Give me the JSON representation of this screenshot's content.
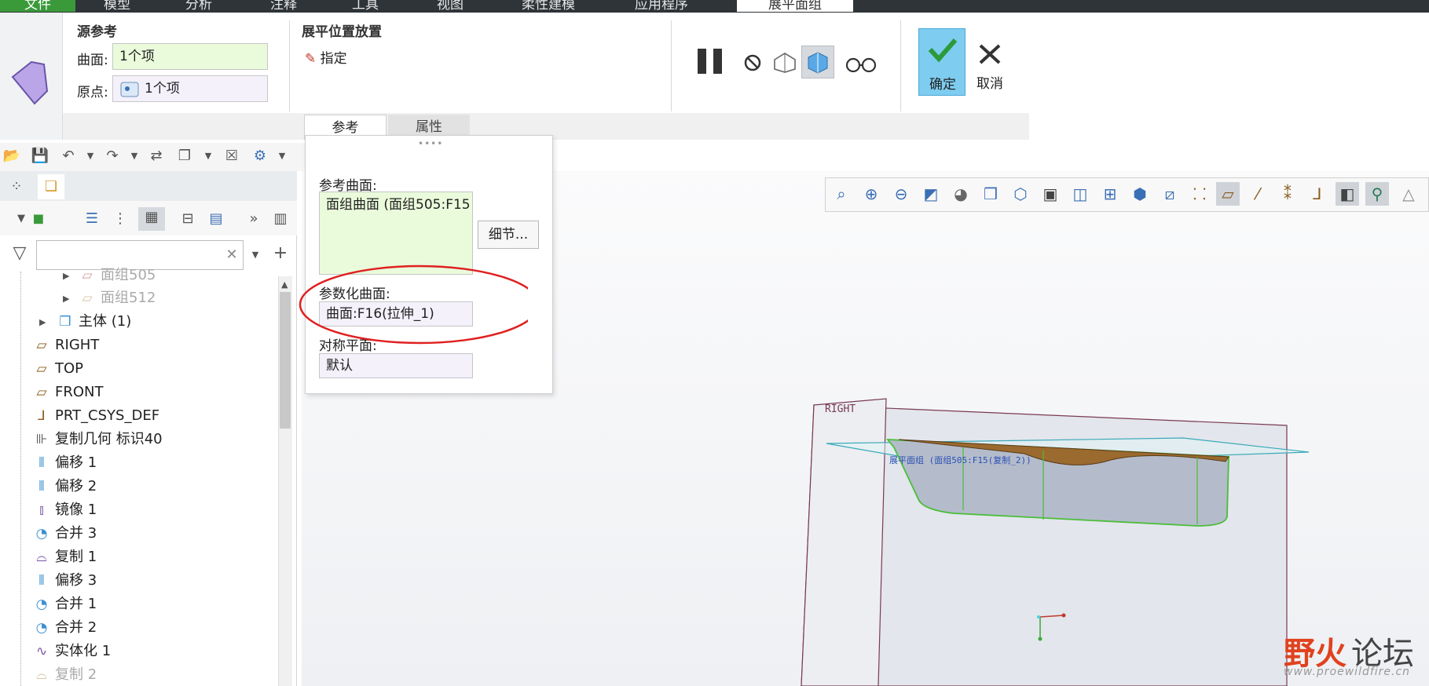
{
  "menu": {
    "tabs": [
      "文件",
      "模型",
      "分析",
      "注释",
      "工具",
      "视图",
      "柔性建模",
      "应用程序",
      "展平面组"
    ],
    "active_tab": "展平面组"
  },
  "ribbon": {
    "source_ref": {
      "title": "源参考",
      "surface_label": "曲面:",
      "surface_value": "1个项",
      "origin_label": "原点:",
      "origin_value": "1个项"
    },
    "placement": {
      "title": "展平位置放置",
      "specify_label": "指定"
    },
    "confirm_label": "确定",
    "cancel_label": "取消"
  },
  "panel_tabs": {
    "references": "参考",
    "properties": "属性"
  },
  "ref_panel": {
    "ref_surface_label": "参考曲面:",
    "ref_surface_value": "面组曲面 (面组505:F15",
    "details_button": "细节...",
    "param_surface_label": "参数化曲面:",
    "param_surface_value": "曲面:F16(拉伸_1)",
    "sym_plane_label": "对称平面:",
    "sym_plane_value": "默认"
  },
  "model_tree": {
    "items": [
      {
        "label": "面组505",
        "icon": "quilt-icon",
        "dim": true
      },
      {
        "label": "面组512",
        "icon": "quilt-icon",
        "dim": true
      },
      {
        "label": "主体 (1)",
        "icon": "body-icon",
        "dim": false
      },
      {
        "label": "RIGHT",
        "icon": "datum-plane-icon",
        "dim": false
      },
      {
        "label": "TOP",
        "icon": "datum-plane-icon",
        "dim": false
      },
      {
        "label": "FRONT",
        "icon": "datum-plane-icon",
        "dim": false
      },
      {
        "label": "PRT_CSYS_DEF",
        "icon": "csys-icon",
        "dim": false
      },
      {
        "label": "复制几何 标识40",
        "icon": "copy-geom-icon",
        "dim": false
      },
      {
        "label": "偏移 1",
        "icon": "offset-icon",
        "dim": false
      },
      {
        "label": "偏移 2",
        "icon": "offset-icon",
        "dim": false
      },
      {
        "label": "镜像 1",
        "icon": "mirror-icon",
        "dim": false
      },
      {
        "label": "合并 3",
        "icon": "merge-icon",
        "dim": false
      },
      {
        "label": "复制 1",
        "icon": "copy-icon",
        "dim": false
      },
      {
        "label": "偏移 3",
        "icon": "offset-icon",
        "dim": false
      },
      {
        "label": "合并 1",
        "icon": "merge-icon",
        "dim": false
      },
      {
        "label": "合并 2",
        "icon": "merge-icon",
        "dim": false
      },
      {
        "label": "实体化 1",
        "icon": "solidify-icon",
        "dim": false
      },
      {
        "label": "复制 2",
        "icon": "copy-icon",
        "dim": true
      }
    ]
  },
  "viewport": {
    "datum_label": "RIGHT",
    "annotation": "展平面组 (面组505:F15(复制_2))"
  },
  "watermark": {
    "brand_a": "野火",
    "brand_b": "论坛",
    "url": "www.proewildfire.cn"
  }
}
